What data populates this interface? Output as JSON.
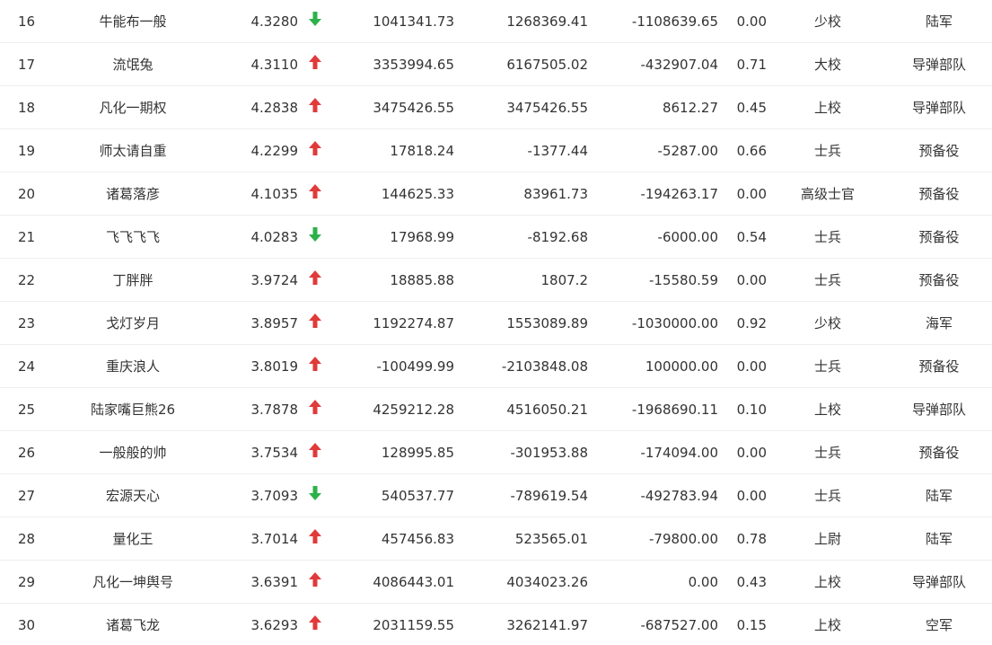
{
  "colors": {
    "up": "#e03a3a",
    "down": "#2db14a",
    "text": "#333333",
    "divider": "#eeeeee"
  },
  "rows": [
    {
      "rank": "16",
      "name": "牛能布一般",
      "score": "4.3280",
      "trend": "down",
      "v1": "1041341.73",
      "v2": "1268369.41",
      "v3": "-1108639.65",
      "ratio": "0.00",
      "level": "少校",
      "branch": "陆军"
    },
    {
      "rank": "17",
      "name": "流氓兔",
      "score": "4.3110",
      "trend": "up",
      "v1": "3353994.65",
      "v2": "6167505.02",
      "v3": "-432907.04",
      "ratio": "0.71",
      "level": "大校",
      "branch": "导弹部队"
    },
    {
      "rank": "18",
      "name": "凡化一期权",
      "score": "4.2838",
      "trend": "up",
      "v1": "3475426.55",
      "v2": "3475426.55",
      "v3": "8612.27",
      "ratio": "0.45",
      "level": "上校",
      "branch": "导弹部队"
    },
    {
      "rank": "19",
      "name": "师太请自重",
      "score": "4.2299",
      "trend": "up",
      "v1": "17818.24",
      "v2": "-1377.44",
      "v3": "-5287.00",
      "ratio": "0.66",
      "level": "士兵",
      "branch": "预备役"
    },
    {
      "rank": "20",
      "name": "诸葛落彦",
      "score": "4.1035",
      "trend": "up",
      "v1": "144625.33",
      "v2": "83961.73",
      "v3": "-194263.17",
      "ratio": "0.00",
      "level": "高级士官",
      "branch": "预备役"
    },
    {
      "rank": "21",
      "name": "飞飞飞飞",
      "score": "4.0283",
      "trend": "down",
      "v1": "17968.99",
      "v2": "-8192.68",
      "v3": "-6000.00",
      "ratio": "0.54",
      "level": "士兵",
      "branch": "预备役"
    },
    {
      "rank": "22",
      "name": "丁胖胖",
      "score": "3.9724",
      "trend": "up",
      "v1": "18885.88",
      "v2": "1807.2",
      "v3": "-15580.59",
      "ratio": "0.00",
      "level": "士兵",
      "branch": "预备役"
    },
    {
      "rank": "23",
      "name": "戈灯岁月",
      "score": "3.8957",
      "trend": "up",
      "v1": "1192274.87",
      "v2": "1553089.89",
      "v3": "-1030000.00",
      "ratio": "0.92",
      "level": "少校",
      "branch": "海军"
    },
    {
      "rank": "24",
      "name": "重庆浪人",
      "score": "3.8019",
      "trend": "up",
      "v1": "-100499.99",
      "v2": "-2103848.08",
      "v3": "100000.00",
      "ratio": "0.00",
      "level": "士兵",
      "branch": "预备役"
    },
    {
      "rank": "25",
      "name": "陆家嘴巨熊26",
      "score": "3.7878",
      "trend": "up",
      "v1": "4259212.28",
      "v2": "4516050.21",
      "v3": "-1968690.11",
      "ratio": "0.10",
      "level": "上校",
      "branch": "导弹部队"
    },
    {
      "rank": "26",
      "name": "一般般的帅",
      "score": "3.7534",
      "trend": "up",
      "v1": "128995.85",
      "v2": "-301953.88",
      "v3": "-174094.00",
      "ratio": "0.00",
      "level": "士兵",
      "branch": "预备役"
    },
    {
      "rank": "27",
      "name": "宏源天心",
      "score": "3.7093",
      "trend": "down",
      "v1": "540537.77",
      "v2": "-789619.54",
      "v3": "-492783.94",
      "ratio": "0.00",
      "level": "士兵",
      "branch": "陆军"
    },
    {
      "rank": "28",
      "name": "量化王",
      "score": "3.7014",
      "trend": "up",
      "v1": "457456.83",
      "v2": "523565.01",
      "v3": "-79800.00",
      "ratio": "0.78",
      "level": "上尉",
      "branch": "陆军"
    },
    {
      "rank": "29",
      "name": "凡化一坤舆号",
      "score": "3.6391",
      "trend": "up",
      "v1": "4086443.01",
      "v2": "4034023.26",
      "v3": "0.00",
      "ratio": "0.43",
      "level": "上校",
      "branch": "导弹部队"
    },
    {
      "rank": "30",
      "name": "诸葛飞龙",
      "score": "3.6293",
      "trend": "up",
      "v1": "2031159.55",
      "v2": "3262141.97",
      "v3": "-687527.00",
      "ratio": "0.15",
      "level": "上校",
      "branch": "空军"
    }
  ]
}
